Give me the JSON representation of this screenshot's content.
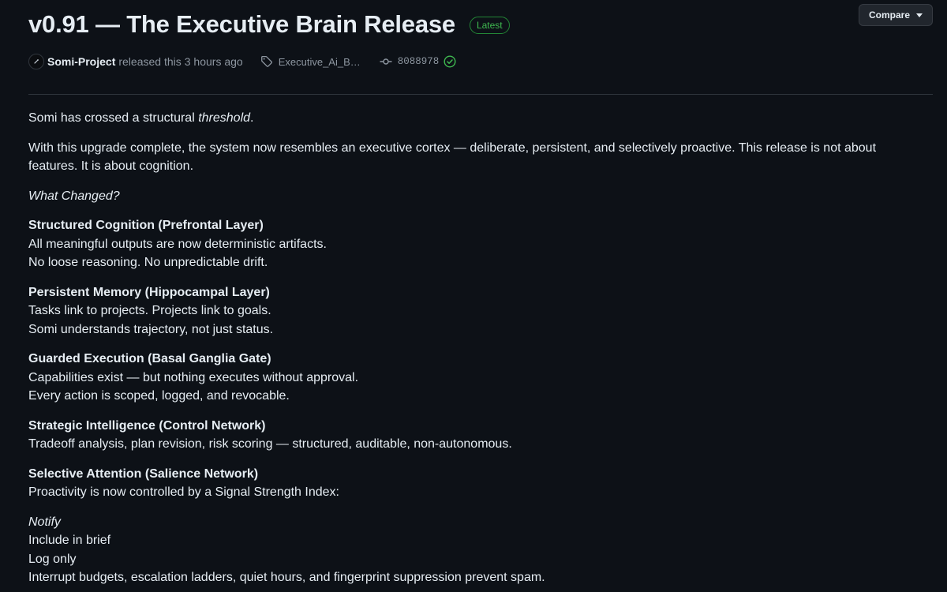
{
  "release": {
    "title": "v0.91 — The Executive Brain Release",
    "badge": "Latest",
    "compare_label": "Compare"
  },
  "meta": {
    "author": "Somi-Project",
    "action_text": "released this",
    "time_ago": "3 hours ago",
    "tag": "Executive_Ai_B…",
    "commit": "8088978"
  },
  "body": {
    "intro_prefix": "Somi has crossed a structural ",
    "intro_emphasis": "threshold",
    "intro_suffix": ".",
    "paragraph2": "With this upgrade complete, the system now resembles an executive cortex — deliberate, persistent, and selectively proactive. This release is not about features. It is about cognition.",
    "what_changed": "What Changed?",
    "sections": [
      {
        "heading": "Structured Cognition (Prefrontal Layer)",
        "lines": [
          "All meaningful outputs are now deterministic artifacts.",
          "No loose reasoning. No unpredictable drift."
        ]
      },
      {
        "heading": "Persistent Memory (Hippocampal Layer)",
        "lines": [
          "Tasks link to projects. Projects link to goals.",
          "Somi understands trajectory, not just status."
        ]
      },
      {
        "heading": "Guarded Execution (Basal Ganglia Gate)",
        "lines": [
          "Capabilities exist — but nothing executes without approval.",
          "Every action is scoped, logged, and revocable."
        ]
      },
      {
        "heading": "Strategic Intelligence (Control Network)",
        "lines": [
          "Tradeoff analysis, plan revision, risk scoring — structured, auditable, non-autonomous."
        ]
      },
      {
        "heading": "Selective Attention (Salience Network)",
        "lines": [
          "Proactivity is now controlled by a Signal Strength Index:"
        ]
      }
    ],
    "ssi_first": "Notify",
    "ssi_lines": [
      "Include in brief",
      "Log only",
      "Interrupt budgets, escalation ladders, quiet hours, and fingerprint suppression prevent spam."
    ]
  },
  "colors": {
    "background": "#0d1117",
    "text": "#e6edf3",
    "muted": "#8d96a0",
    "success": "#3fb950",
    "border": "#30363d"
  },
  "icons": {
    "avatar": "avatar",
    "tag": "tag-icon",
    "commit": "git-commit-icon",
    "verified": "check-circle-icon",
    "dropdown": "caret-down-icon"
  }
}
